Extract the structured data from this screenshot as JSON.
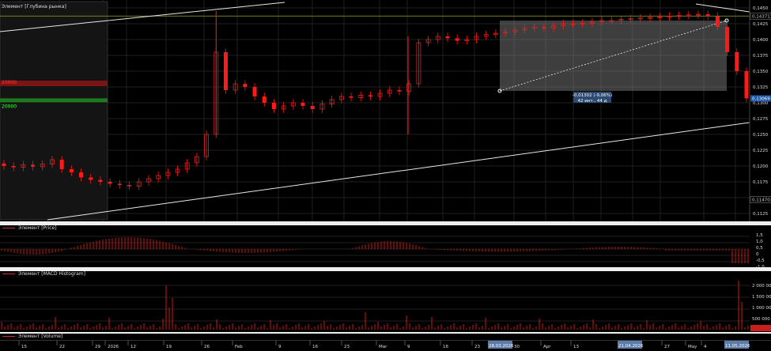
{
  "panes": {
    "price_legend": "Элемент [Price]",
    "macd_legend": "Элемент [MACD Histogram]",
    "volume_legend": "Элемент [Volume]",
    "depth_label": "Элемент [Глубина рынка]"
  },
  "depth": {
    "ask_level": "20000",
    "bid_level": "20000"
  },
  "price_axis": {
    "ticks": [
      "0,1450",
      "0,1425",
      "0,1400",
      "0,1375",
      "0,1350",
      "0,1325",
      "0,1300",
      "0,1275",
      "0,1250",
      "0,1225",
      "0,1200",
      "0,1175",
      "0,1150",
      "0,1125"
    ],
    "high_badge": "0,14371",
    "last_badge": "0,13069",
    "low_badge": "0,11470"
  },
  "measure": {
    "change": "-0,01302 (-9,06%)",
    "span": "42 инт., 44 д"
  },
  "macd_axis": {
    "ticks": [
      "1,5",
      "1,0",
      "0,5",
      "0",
      "-0,5",
      "-1,0"
    ]
  },
  "volume_axis": {
    "ticks": [
      "2 000 00.",
      "1 500 00.",
      "1 000 00.",
      "500 000"
    ]
  },
  "time_axis": {
    "ticks": [
      "15",
      "22",
      "29",
      "2026",
      "12",
      "19",
      "26",
      "Feb",
      "9",
      "16",
      "23",
      "Mar",
      "9",
      "16",
      "23",
      "30",
      "Apr",
      "13",
      "20",
      "27",
      "4",
      "May",
      "11"
    ],
    "date_badges": [
      "28.03.2026",
      "21.04.2026",
      "11.05.2026"
    ]
  },
  "colors": {
    "bull": "#e02020",
    "bear": "#ff1a1a",
    "grid": "#1f1f1f",
    "trend": "#e8e8e8",
    "background": "#000000"
  },
  "chart_data": {
    "type": "candlestick",
    "ylim": [
      0.1115,
      0.146
    ],
    "close": [
      0.12,
      0.1198,
      0.1202,
      0.1199,
      0.1203,
      0.121,
      0.1195,
      0.119,
      0.1182,
      0.1178,
      0.1175,
      0.1172,
      0.117,
      0.1168,
      0.1175,
      0.118,
      0.1185,
      0.119,
      0.1195,
      0.1205,
      0.1215,
      0.125,
      0.138,
      0.132,
      0.133,
      0.1325,
      0.131,
      0.13,
      0.129,
      0.1295,
      0.13,
      0.1295,
      0.129,
      0.1298,
      0.1305,
      0.131,
      0.1308,
      0.1312,
      0.131,
      0.1315,
      0.132,
      0.1318,
      0.133,
      0.1395,
      0.14,
      0.1405,
      0.1402,
      0.1398,
      0.14,
      0.1405,
      0.1408,
      0.141,
      0.1412,
      0.1415,
      0.1418,
      0.142,
      0.1418,
      0.1422,
      0.1425,
      0.1425,
      0.1426,
      0.1428,
      0.143,
      0.143,
      0.1432,
      0.1433,
      0.1434,
      0.1435,
      0.1436,
      0.1437,
      0.1438,
      0.1439,
      0.144,
      0.1437,
      0.142,
      0.138,
      0.135,
      0.1307
    ]
  }
}
